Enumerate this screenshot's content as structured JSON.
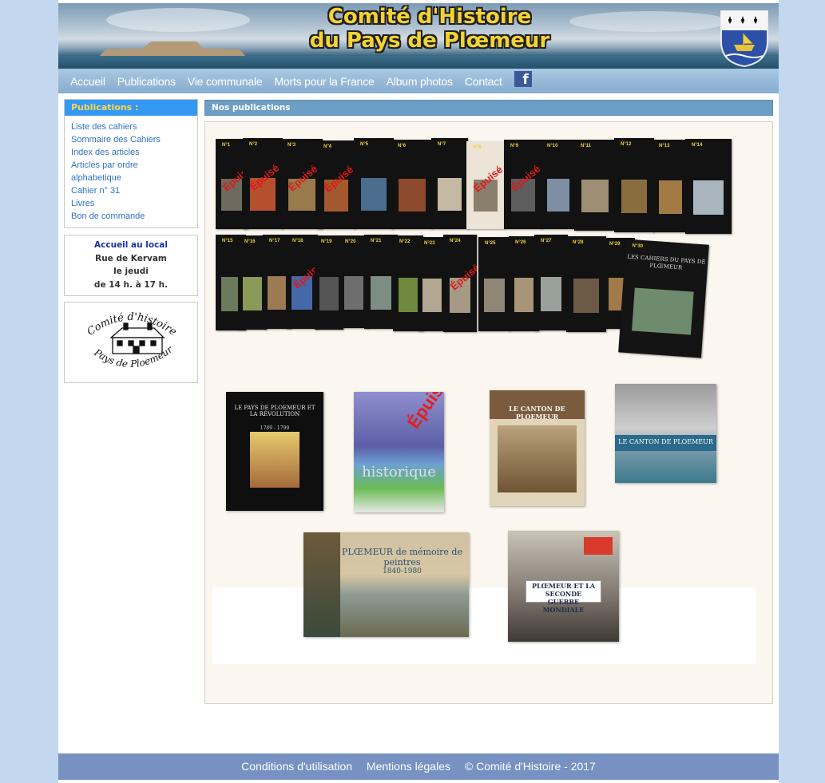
{
  "header": {
    "title_line1": "Comité d'Histoire",
    "title_line2": "du Pays de Plœmeur",
    "coat_of_arms": "ploemeur-coat-of-arms"
  },
  "nav": {
    "items": [
      "Accueil",
      "Publications",
      "Vie communale",
      "Morts pour la France",
      "Album photos",
      "Contact"
    ],
    "facebook_icon": "f"
  },
  "sidebar": {
    "publications_title": "Publications :",
    "links": [
      "Liste des cahiers",
      "Sommaire des Cahiers",
      "Index des articles",
      "Articles par ordre alphabetique",
      "Cahier n° 31",
      "Livres",
      "Bon de commande"
    ],
    "local": {
      "title": "Accueil au local",
      "street": "Rue de Kervam",
      "day": "le jeudi",
      "hours": "de 14 h. à 17 h."
    },
    "logo": {
      "line1": "Comité d'histoire",
      "line2": "Pays de Ploemeur"
    }
  },
  "main": {
    "heading": "Nos publications",
    "cahiers_row1": [
      "N°1",
      "N°2",
      "N°3",
      "N°4",
      "N°5",
      "N°6",
      "N°7",
      "N°8",
      "N°9",
      "N°10",
      "N°11",
      "N°12",
      "N°13",
      "N°14"
    ],
    "cahiers_row2": [
      "N°15",
      "N°16",
      "N°17",
      "N°18",
      "N°19",
      "N°20",
      "N°21",
      "N°22",
      "N°23",
      "N°24",
      "N°25",
      "N°26",
      "N°27",
      "N°28",
      "N°29",
      "N°30"
    ],
    "big_cahier_title": "LES CAHIERS DU PAYS DE PLŒMEUR",
    "epuise_label": "Épuisé",
    "books": [
      {
        "title": "LE PAYS DE PLOEMEUR ET LA RÉVOLUTION",
        "subtitle": "1789 - 1799"
      },
      {
        "title": "historique",
        "subtitle": "Épuisé"
      },
      {
        "title": "LE CANTON DE PLOEMEUR",
        "subtitle": ""
      },
      {
        "title": "LE CANTON DE PLOEMEUR",
        "subtitle": ""
      },
      {
        "title": "PLŒMEUR de mémoire de peintres",
        "subtitle": "1840-1980"
      },
      {
        "title": "PLŒMEUR ET LA SECONDE GUERRE MONDIALE",
        "subtitle": ""
      }
    ]
  },
  "footer": {
    "links": [
      "Conditions d'utilisation",
      "Mentions légales",
      "© Comité d'Histoire - 2017"
    ]
  },
  "colors": {
    "background": "#c3d8ee",
    "nav": "#86acd0",
    "sidebar_header": "#3399f3",
    "section_header": "#6d9ec5",
    "panel": "#fbf6ef",
    "footer": "#7691c2",
    "title_yellow": "#f3d234"
  }
}
